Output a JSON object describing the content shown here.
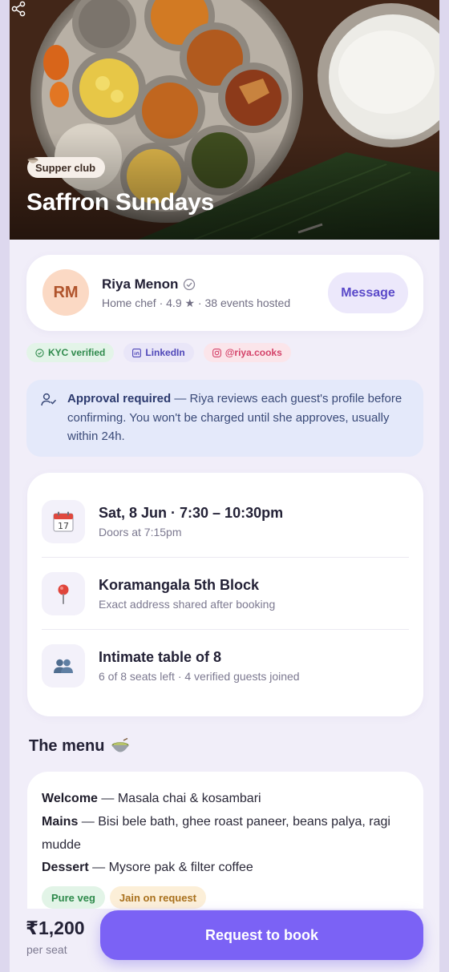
{
  "hero": {
    "chip_label": "Supper club",
    "title": "Saffron Sundays"
  },
  "host": {
    "initials": "RM",
    "name": "Riya Menon",
    "meta": "Home chef · 4.9 ★ · 38 events hosted",
    "message_label": "Message"
  },
  "badges": [
    {
      "label": "KYC verified"
    },
    {
      "label": "LinkedIn"
    },
    {
      "label": "@riya.cooks"
    }
  ],
  "approval": {
    "heading": "Approval required",
    "body": " — Riya reviews each guest's profile before confirming. You won't be charged until she approves, usually within 24h."
  },
  "details": [
    {
      "icon": "calendar-icon",
      "title": "Sat, 8 Jun · 7:30 – 10:30pm",
      "sub": "Doors at 7:15pm"
    },
    {
      "icon": "map-pin-icon",
      "title": "Koramangala 5th Block",
      "sub": "Exact address shared after booking"
    },
    {
      "icon": "guests-icon",
      "title": "Intimate table of 8",
      "sub": "6 of 8 seats left · 4 verified guests joined"
    }
  ],
  "menu": {
    "heading": "The menu",
    "courses": [
      {
        "name": "Welcome",
        "items": " — Masala chai & kosambari"
      },
      {
        "name": "Mains",
        "items": " — Bisi bele bath, ghee roast paneer, beans palya, ragi mudde"
      },
      {
        "name": "Dessert",
        "items": " — Mysore pak & filter coffee"
      }
    ],
    "tags": [
      "Pure veg",
      "Jain on request"
    ]
  },
  "footer": {
    "price": "₹1,200",
    "per_seat": "per seat",
    "cta_label": "Request to book"
  },
  "colors": {
    "accent": "#7b62f5",
    "page_background": "#f1eef9",
    "approval_background": "#e4e9fa"
  }
}
